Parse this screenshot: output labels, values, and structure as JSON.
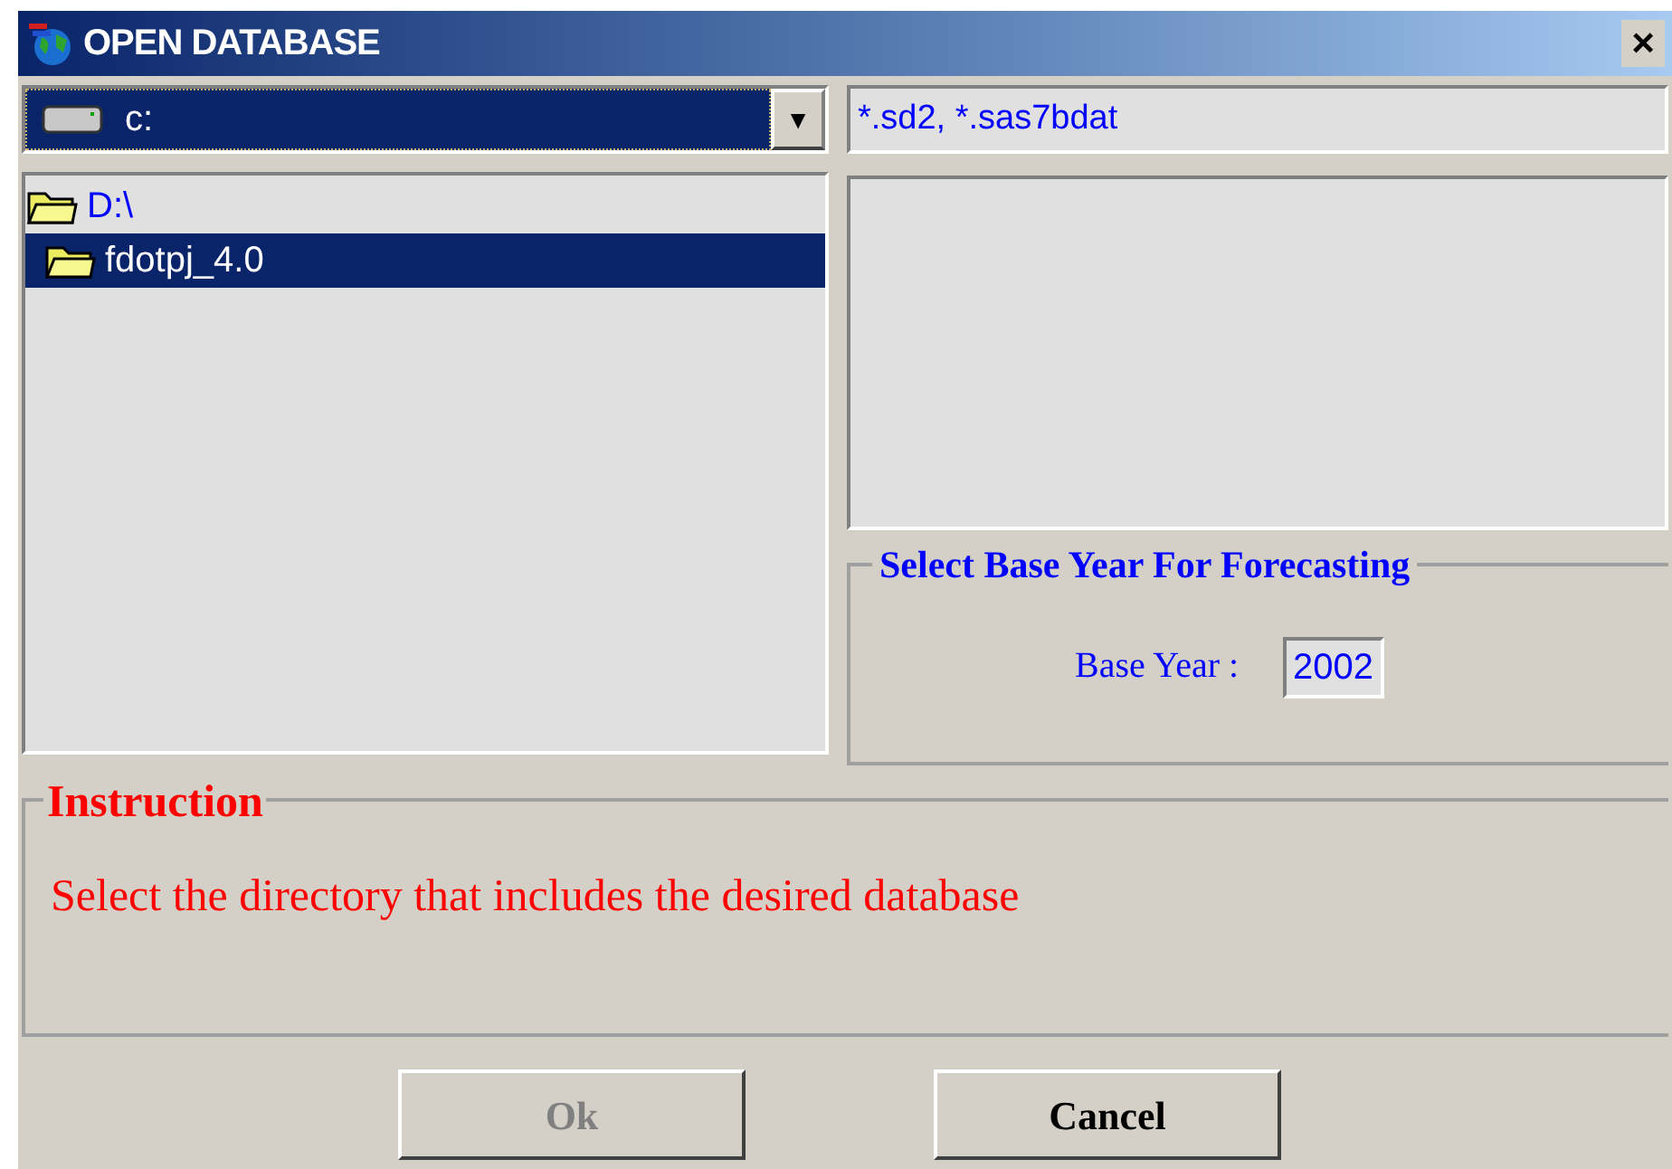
{
  "window": {
    "title": "OPEN DATABASE",
    "close": "×"
  },
  "drive_select": {
    "value": "c:",
    "arrow": "▼"
  },
  "filter": {
    "value": "*.sd2,  *.sas7bdat"
  },
  "directories": [
    {
      "label": "D:\\",
      "selected": false,
      "children": [
        {
          "label": "fdotpj_4.0",
          "selected": true
        }
      ]
    }
  ],
  "base_year_group": {
    "title": "Select Base Year For Forecasting",
    "label": "Base Year :",
    "value": "2002"
  },
  "instruction": {
    "title": "Instruction",
    "text": "Select the directory that includes the desired database"
  },
  "buttons": [
    {
      "label": "Ok",
      "disabled": true
    },
    {
      "label": "Cancel",
      "disabled": false
    }
  ]
}
